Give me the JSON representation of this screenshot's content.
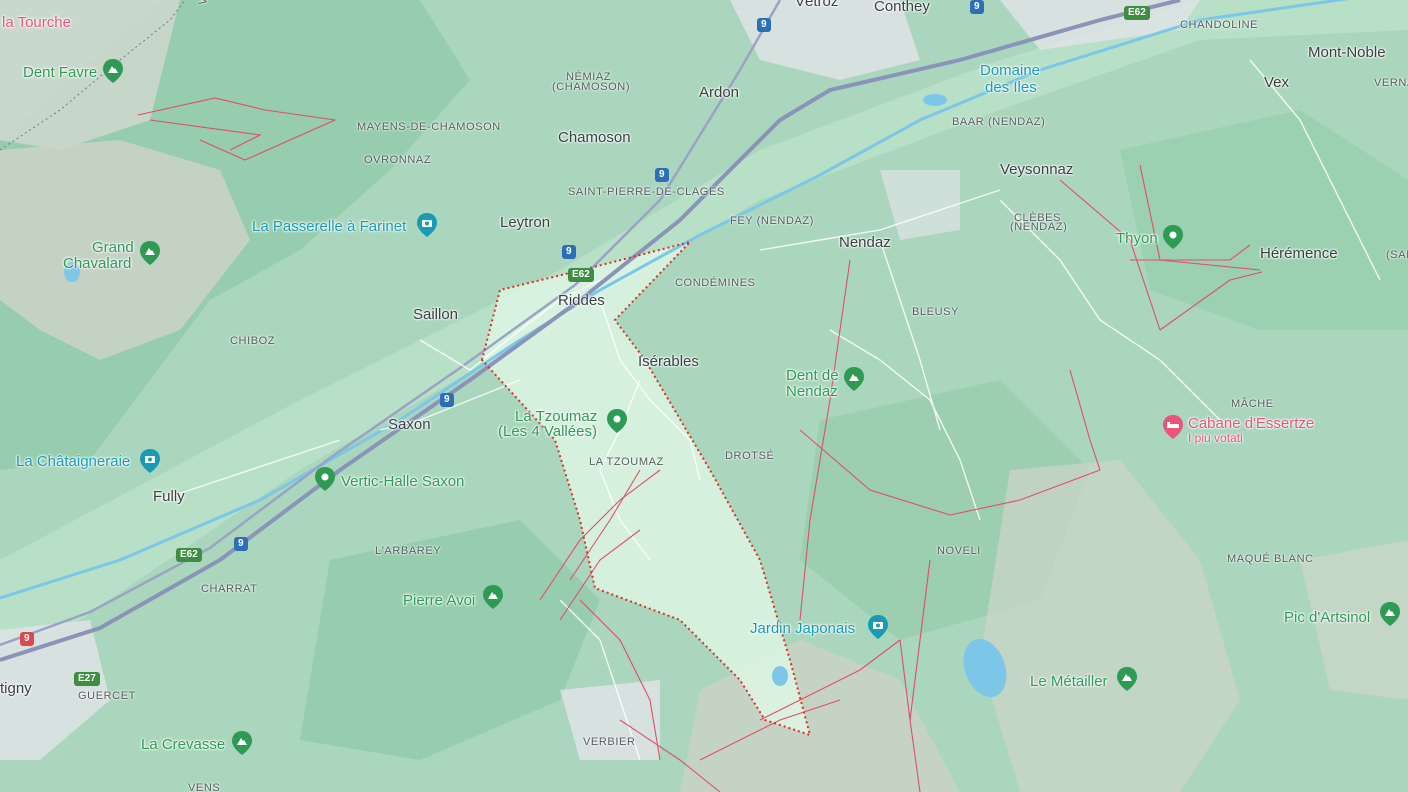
{
  "colors": {
    "park_poi": "#2e9b55",
    "photo_poi": "#1a9bb5",
    "hotel_poi": "#e8547a",
    "highway": "#8a93b8",
    "boundary": "#d93025",
    "ski_lift": "#e04e6a",
    "water": "#7cc6e8",
    "highlight_area": "#dcf7e4",
    "shield_green": "#3e8e41",
    "shield_blue": "#2d6fb7",
    "shield_red": "#d94a4a"
  },
  "places": [
    {
      "id": "la-tourche",
      "label": "la Tourche",
      "type": "poi-red"
    },
    {
      "id": "vetroz",
      "label": "Vétroz",
      "type": "place"
    },
    {
      "id": "conthey",
      "label": "Conthey",
      "type": "place"
    },
    {
      "id": "chandoline",
      "label": "CHANDOLINE",
      "type": "small"
    },
    {
      "id": "mont-noble",
      "label": "Mont-Noble",
      "type": "place"
    },
    {
      "id": "vex",
      "label": "Vex",
      "type": "place"
    },
    {
      "id": "verna",
      "label": "VERNA",
      "type": "small"
    },
    {
      "id": "dent-favre",
      "label": "Dent Favre",
      "type": "poi-green"
    },
    {
      "id": "nemiaz",
      "label": "NÉMIAZ",
      "type": "small"
    },
    {
      "id": "nemiaz-sub",
      "label": "(CHAMOSON)",
      "type": "small"
    },
    {
      "id": "ardon",
      "label": "Ardon",
      "type": "place"
    },
    {
      "id": "domaine",
      "label": "Domaine",
      "type": "poi-teal"
    },
    {
      "id": "des-iles",
      "label": "des Iles",
      "type": "poi-teal"
    },
    {
      "id": "mayens",
      "label": "MAYENS-DE-CHAMOSON",
      "type": "small"
    },
    {
      "id": "baar",
      "label": "BAAR (NENDAZ)",
      "type": "small"
    },
    {
      "id": "chamoson",
      "label": "Chamoson",
      "type": "place"
    },
    {
      "id": "ovronnaz",
      "label": "OVRONNAZ",
      "type": "small"
    },
    {
      "id": "veysonnaz",
      "label": "Veysonnaz",
      "type": "place"
    },
    {
      "id": "st-pierre",
      "label": "SAINT-PIERRE-DE-CLAGES",
      "type": "small"
    },
    {
      "id": "leytron",
      "label": "Leytron",
      "type": "place"
    },
    {
      "id": "fey",
      "label": "FEY (NENDAZ)",
      "type": "small"
    },
    {
      "id": "clebes",
      "label": "CLÈBES",
      "type": "small"
    },
    {
      "id": "clebes-sub",
      "label": "(NENDAZ)",
      "type": "small"
    },
    {
      "id": "passerelle",
      "label": "La Passerelle à Farinet",
      "type": "poi-teal"
    },
    {
      "id": "thyon",
      "label": "Thyon",
      "type": "poi-green"
    },
    {
      "id": "nendaz",
      "label": "Nendaz",
      "type": "place"
    },
    {
      "id": "grand",
      "label": "Grand",
      "type": "poi-green"
    },
    {
      "id": "chavalard",
      "label": "Chavalard",
      "type": "poi-green"
    },
    {
      "id": "heremence",
      "label": "Hérémence",
      "type": "place"
    },
    {
      "id": "sai",
      "label": "(SAI",
      "type": "small"
    },
    {
      "id": "condemines",
      "label": "CONDÉMINES",
      "type": "small"
    },
    {
      "id": "riddes",
      "label": "Riddes",
      "type": "place"
    },
    {
      "id": "saillon",
      "label": "Saillon",
      "type": "place"
    },
    {
      "id": "bleusy",
      "label": "BLEUSY",
      "type": "small"
    },
    {
      "id": "chiboz",
      "label": "CHIBOZ",
      "type": "small"
    },
    {
      "id": "iserables",
      "label": "Isérables",
      "type": "place"
    },
    {
      "id": "dent-de",
      "label": "Dent de",
      "type": "poi-green"
    },
    {
      "id": "nendaz-poi",
      "label": "Nendaz",
      "type": "poi-green"
    },
    {
      "id": "mache",
      "label": "MÂCHE",
      "type": "small"
    },
    {
      "id": "tzoumaz-poi",
      "label": "La Tzoumaz",
      "type": "poi-green"
    },
    {
      "id": "tzoumaz-poi-sub",
      "label": "(Les 4 Vallées)",
      "type": "poi-green"
    },
    {
      "id": "saxon",
      "label": "Saxon",
      "type": "place"
    },
    {
      "id": "cabane",
      "label": "Cabane d'Essertze",
      "type": "poi-red"
    },
    {
      "id": "cabane-sub",
      "label": "I più votati",
      "type": "poi-red-sub"
    },
    {
      "id": "chataigneraie",
      "label": "La Châtaigneraie",
      "type": "poi-teal"
    },
    {
      "id": "drotse",
      "label": "DROTSÉ",
      "type": "small"
    },
    {
      "id": "tzoumaz-sm",
      "label": "LA TZOUMAZ",
      "type": "small"
    },
    {
      "id": "fully",
      "label": "Fully",
      "type": "place"
    },
    {
      "id": "vertic",
      "label": "Vertic-Halle Saxon",
      "type": "poi-green"
    },
    {
      "id": "larbarey",
      "label": "L'ARBAREY",
      "type": "small"
    },
    {
      "id": "noveli",
      "label": "NOVELI",
      "type": "small"
    },
    {
      "id": "maque",
      "label": "MAQUÉ BLANC",
      "type": "small"
    },
    {
      "id": "charrat",
      "label": "CHARRAT",
      "type": "small"
    },
    {
      "id": "pierre-avoi",
      "label": "Pierre Avoi",
      "type": "poi-green"
    },
    {
      "id": "pic",
      "label": "Pic d'Artsinol",
      "type": "poi-green"
    },
    {
      "id": "jardin",
      "label": "Jardin Japonais",
      "type": "poi-teal"
    },
    {
      "id": "le-metailler",
      "label": "Le Métailler",
      "type": "poi-green"
    },
    {
      "id": "tigny",
      "label": "tigny",
      "type": "place"
    },
    {
      "id": "guercet",
      "label": "GUERCET",
      "type": "small"
    },
    {
      "id": "verbier",
      "label": "VERBIER",
      "type": "small"
    },
    {
      "id": "la-crevasse",
      "label": "La Crevasse",
      "type": "poi-green"
    },
    {
      "id": "vens",
      "label": "VENS",
      "type": "small"
    },
    {
      "id": "va",
      "label": "VA",
      "type": "small"
    }
  ],
  "road_shields": [
    {
      "id": "s9-a",
      "text": "9",
      "kind": "blue"
    },
    {
      "id": "s9-b",
      "text": "9",
      "kind": "blue"
    },
    {
      "id": "e62-a",
      "text": "E62",
      "kind": "green"
    },
    {
      "id": "s9-c",
      "text": "9",
      "kind": "blue"
    },
    {
      "id": "s9-d",
      "text": "9",
      "kind": "blue"
    },
    {
      "id": "e62-b",
      "text": "E62",
      "kind": "green"
    },
    {
      "id": "s9-e",
      "text": "9",
      "kind": "blue"
    },
    {
      "id": "e62-c",
      "text": "E62",
      "kind": "green"
    },
    {
      "id": "s9-f",
      "text": "9",
      "kind": "blue"
    },
    {
      "id": "s9-g",
      "text": "9",
      "kind": "red"
    },
    {
      "id": "e27",
      "text": "E27",
      "kind": "green"
    }
  ]
}
